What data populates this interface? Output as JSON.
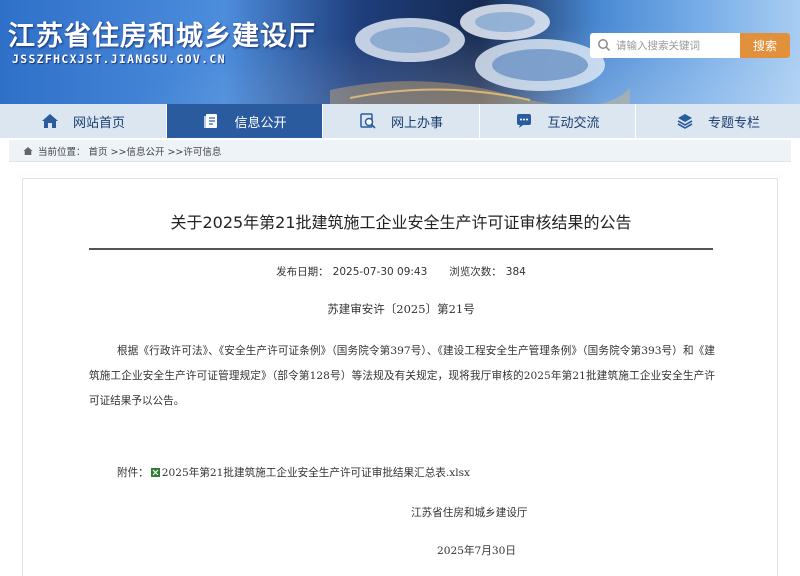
{
  "header": {
    "site_title": "江苏省住房和城乡建设厅",
    "site_url": "JSSZFHCXJST.JIANGSU.GOV.CN",
    "search_placeholder": "请输入搜索关键词",
    "search_button": "搜索"
  },
  "nav": {
    "items": [
      {
        "label": "网站首页",
        "icon": "home-icon",
        "active": false
      },
      {
        "label": "信息公开",
        "icon": "document-icon",
        "active": true
      },
      {
        "label": "网上办事",
        "icon": "search-doc-icon",
        "active": false
      },
      {
        "label": "互动交流",
        "icon": "chat-icon",
        "active": false
      },
      {
        "label": "专题专栏",
        "icon": "layers-icon",
        "active": false
      }
    ]
  },
  "breadcrumb": {
    "prefix": "当前位置：",
    "items": [
      "首页",
      ">>信息公开",
      ">>许可信息"
    ]
  },
  "article": {
    "title": "关于2025年第21批建筑施工企业安全生产许可证审核结果的公告",
    "publish_label": "发布日期：",
    "publish_date": "2025-07-30 09:43",
    "views_label": "浏览次数：",
    "views": "384",
    "doc_number": "苏建审安许〔2025〕第21号",
    "body": "根据《行政许可法》、《安全生产许可证条例》（国务院令第397号）、《建设工程安全生产管理条例》（国务院令第393号）和《建筑施工企业安全生产许可证管理规定》（部令第128号）等法规及有关规定，现将我厅审核的2025年第21批建筑施工企业安全生产许可证结果予以公告。",
    "attachment_label": "附件：",
    "attachment_name": "2025年第21批建筑施工企业安全生产许可证审批结果汇总表.xlsx",
    "sign_org": "江苏省住房和城乡建设厅",
    "sign_date": "2025年7月30日"
  },
  "colors": {
    "nav_active": "#2a5b9e",
    "nav_bg": "#dce6f1",
    "search_button": "#e1913c"
  }
}
